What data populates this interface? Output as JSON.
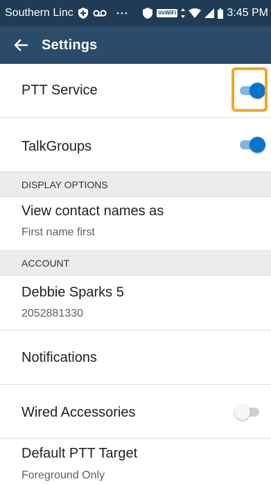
{
  "status_bar": {
    "carrier": "Southern Linc",
    "vowifi": "VoWiFi",
    "time": "3:45 PM"
  },
  "app_bar": {
    "title": "Settings"
  },
  "settings": {
    "ptt_service": {
      "label": "PTT Service",
      "enabled": true
    },
    "talkgroups": {
      "label": "TalkGroups",
      "enabled": true
    },
    "display_options_header": "DISPLAY OPTIONS",
    "view_contact_names": {
      "label": "View contact names as",
      "value": "First name first"
    },
    "account_header": "ACCOUNT",
    "account": {
      "name": "Debbie Sparks 5",
      "number": "2052881330"
    },
    "notifications": {
      "label": "Notifications"
    },
    "wired_accessories": {
      "label": "Wired Accessories",
      "enabled": false
    },
    "default_ptt_target": {
      "label": "Default PTT Target",
      "value": "Foreground Only"
    }
  },
  "colors": {
    "status_bar_bg": "#1f3b56",
    "app_bar_bg": "#2b4b6a",
    "toggle_on": "#0a74c9",
    "highlight": "#f2a91b"
  }
}
